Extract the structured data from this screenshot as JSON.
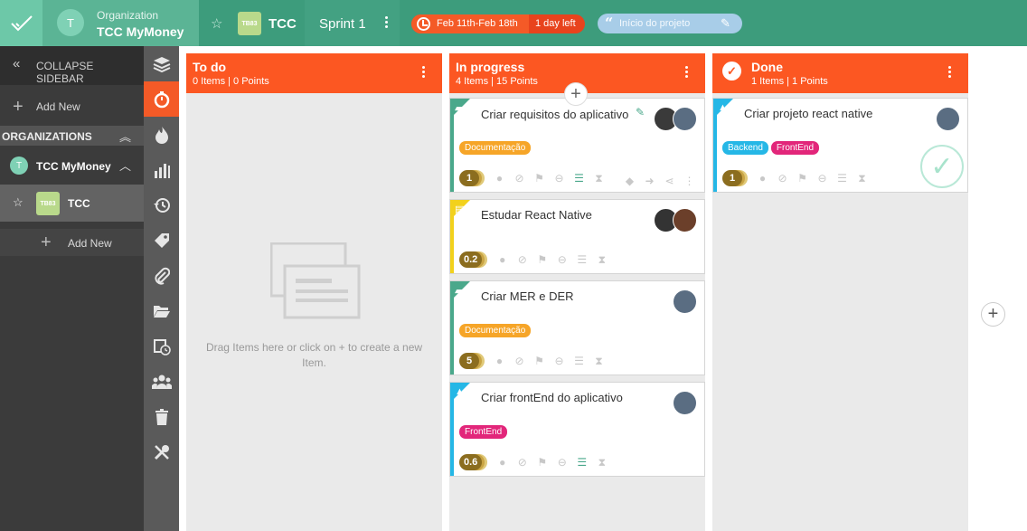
{
  "header": {
    "org_small": "Organization",
    "org_name": "TCC MyMoney",
    "org_initial": "T",
    "project_badge": "TB83",
    "project_name": "TCC",
    "sprint_name": "Sprint 1",
    "sprint_dates": "Feb 11th-Feb 18th",
    "days_left": "1 day left",
    "goal": "Início do projeto"
  },
  "sidebar": {
    "collapse": "COLLAPSE SIDEBAR",
    "add_new": "Add New",
    "organizations": "ORGANIZATIONS",
    "org_initial": "T",
    "org_name": "TCC MyMoney",
    "project_badge": "TB83",
    "project_name": "TCC",
    "project_add_new": "Add New"
  },
  "rail": [
    "layers-icon",
    "timer-icon",
    "fire-icon",
    "chart-icon",
    "history-icon",
    "tag-icon",
    "attachment-icon",
    "folder-icon",
    "calendar-icon",
    "team-icon",
    "trash-icon",
    "tools-icon"
  ],
  "columns": [
    {
      "title": "To do",
      "summary": "0 Items | 0 Points",
      "empty_text": "Drag Items here or click on + to create a new Item."
    },
    {
      "title": "In progress",
      "summary": "4 Items | 15 Points",
      "cards": [
        {
          "title": "Criar requisitos do aplicativo",
          "type": "book-icon",
          "color": "#4aa88b",
          "tags": [
            {
              "label": "Documentação",
              "color": "#f6a528"
            }
          ],
          "points": "1",
          "avatars": 2
        },
        {
          "title": "Estudar React Native",
          "type": "note-icon",
          "color": "#f2d11c",
          "tags": [],
          "points": "0.2",
          "avatars": 2
        },
        {
          "title": "Criar MER e DER",
          "type": "book-icon",
          "color": "#4aa88b",
          "tags": [
            {
              "label": "Documentação",
              "color": "#f6a528"
            }
          ],
          "points": "5",
          "avatars": 1
        },
        {
          "title": "Criar frontEnd do aplicativo",
          "type": "arrow-up-icon",
          "color": "#25b7e6",
          "tags": [
            {
              "label": "FrontEnd",
              "color": "#e2267a"
            }
          ],
          "points": "0.6",
          "avatars": 1
        }
      ]
    },
    {
      "title": "Done",
      "summary": "1 Items | 1 Points",
      "cards": [
        {
          "title": "Criar projeto react native",
          "type": "arrow-up-icon",
          "color": "#25b7e6",
          "tags": [
            {
              "label": "Backend",
              "color": "#25b7e6"
            },
            {
              "label": "FrontEnd",
              "color": "#e2267a"
            }
          ],
          "points": "1",
          "avatars": 1
        }
      ]
    }
  ]
}
